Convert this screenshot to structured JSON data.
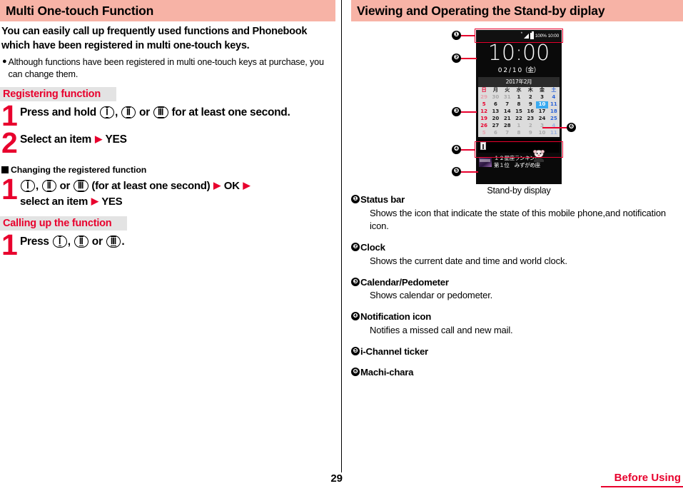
{
  "left": {
    "section_title": "Multi One-touch Function",
    "lead": "You can easily call up frequently used functions and Phonebook which have been registered in multi one-touch keys.",
    "bullet": "Although functions have been registered in multi one-touch keys at purchase, you can change them.",
    "sub1_title": "Registering function",
    "step1_num": "1",
    "step1_pre": "Press and hold",
    "step1_mid": "or",
    "step1_post": "for at least one second.",
    "step1_comma": ",",
    "step2_num": "2",
    "step2_text": "Select an item",
    "step2_yes": "YES",
    "square_title": "Changing the registered function",
    "step3_num": "1",
    "step3_comma": ",",
    "step3_mid": "or",
    "step3_paren": "(for at least one second)",
    "step3_ok": "OK",
    "step3_tail": "select an item",
    "step3_yes": "YES",
    "sub2_title": "Calling up the function",
    "step4_num": "1",
    "step4_pre": "Press",
    "step4_comma": ",",
    "step4_mid": "or",
    "step4_period": ".",
    "key1": "Ⅰ",
    "key2": "Ⅱ",
    "key3": "Ⅲ",
    "arrow": "▶"
  },
  "right": {
    "section_title": "Viewing and Operating the Stand-by diplay",
    "caption": "Stand-by display",
    "phone": {
      "status_percent": "100%",
      "status_time": "10:00",
      "status_asterisk": "*",
      "clock_time": "10:00",
      "clock_date": "0 2 / 1 0（金）",
      "calendar_title": "2017年2月",
      "weekdays": [
        "日",
        "月",
        "火",
        "水",
        "木",
        "金",
        "土"
      ],
      "weeks": [
        [
          {
            "d": "29",
            "t": "dimsun"
          },
          {
            "d": "30",
            "t": "dim"
          },
          {
            "d": "31",
            "t": "dim"
          },
          {
            "d": "1",
            "t": "wd"
          },
          {
            "d": "2",
            "t": "wd"
          },
          {
            "d": "3",
            "t": "wd"
          },
          {
            "d": "4",
            "t": "sat"
          }
        ],
        [
          {
            "d": "5",
            "t": "sun"
          },
          {
            "d": "6",
            "t": "wd"
          },
          {
            "d": "7",
            "t": "wd"
          },
          {
            "d": "8",
            "t": "wd"
          },
          {
            "d": "9",
            "t": "wd"
          },
          {
            "d": "10",
            "t": "today"
          },
          {
            "d": "11",
            "t": "sat"
          }
        ],
        [
          {
            "d": "12",
            "t": "sun"
          },
          {
            "d": "13",
            "t": "wd"
          },
          {
            "d": "14",
            "t": "wd"
          },
          {
            "d": "15",
            "t": "wd"
          },
          {
            "d": "16",
            "t": "wd"
          },
          {
            "d": "17",
            "t": "wd"
          },
          {
            "d": "18",
            "t": "sat"
          }
        ],
        [
          {
            "d": "19",
            "t": "sun"
          },
          {
            "d": "20",
            "t": "wd"
          },
          {
            "d": "21",
            "t": "wd"
          },
          {
            "d": "22",
            "t": "wd"
          },
          {
            "d": "23",
            "t": "wd"
          },
          {
            "d": "24",
            "t": "wd"
          },
          {
            "d": "25",
            "t": "sat"
          }
        ],
        [
          {
            "d": "26",
            "t": "sun"
          },
          {
            "d": "27",
            "t": "wd"
          },
          {
            "d": "28",
            "t": "wd"
          },
          {
            "d": "1",
            "t": "dim"
          },
          {
            "d": "2",
            "t": "dim"
          },
          {
            "d": "3",
            "t": "dim"
          },
          {
            "d": "4",
            "t": "dimsat"
          }
        ],
        [
          {
            "d": "5",
            "t": "dimsun"
          },
          {
            "d": "6",
            "t": "dim"
          },
          {
            "d": "7",
            "t": "dim"
          },
          {
            "d": "8",
            "t": "dim"
          },
          {
            "d": "9",
            "t": "dim"
          },
          {
            "d": "10",
            "t": "dim"
          },
          {
            "d": "11",
            "t": "dimsat"
          }
        ]
      ],
      "ticker_line1": "１２星座ランキング",
      "ticker_line2": "第１位　みずがめ座"
    },
    "callouts": [
      "1",
      "2",
      "3",
      "4",
      "5",
      "6"
    ],
    "descriptions": [
      {
        "num": "1",
        "title": "Status bar",
        "text": "Shows the icon that indicate the state of this mobile phone,and notification icon."
      },
      {
        "num": "2",
        "title": "Clock",
        "text": "Shows the current date and time and world clock."
      },
      {
        "num": "3",
        "title": "Calendar/Pedometer",
        "text": "Shows calendar or pedometer."
      },
      {
        "num": "4",
        "title": "Notification icon",
        "text": "Notifies a missed call and new mail."
      },
      {
        "num": "5",
        "title": "i-Channel ticker",
        "text": ""
      },
      {
        "num": "6",
        "title": "Machi-chara",
        "text": ""
      }
    ]
  },
  "footer": {
    "page_number": "29",
    "chapter": "Before Using"
  },
  "colors": {
    "header_pink": "#f7b3a6",
    "accent_red": "#e8002d",
    "sub_header_bg": "#e3e3e3",
    "today_blue": "#3aaaf0"
  }
}
